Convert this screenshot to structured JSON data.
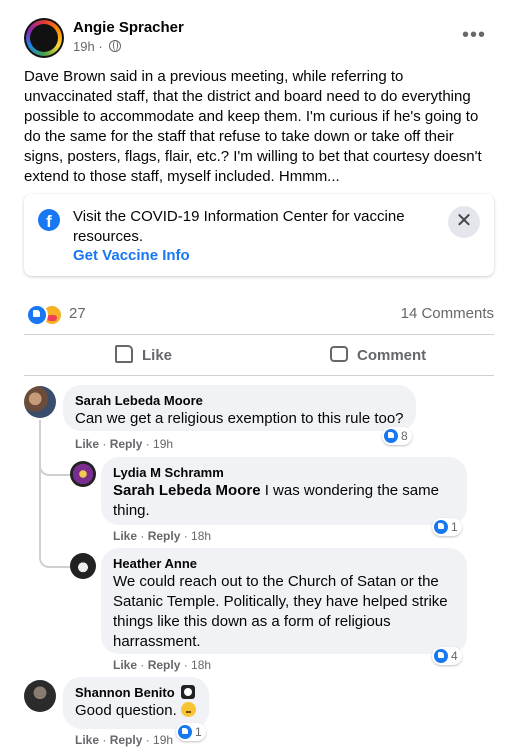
{
  "post": {
    "author": "Angie Spracher",
    "time": "19h",
    "text": "Dave Brown said in a previous meeting, while referring to unvaccinated staff, that the district and board need to do everything possible to accommodate and keep them. I'm curious if he's going to do the same for the staff that refuse to take down or take off their signs, posters, flags, flair, etc.? I'm willing to bet that courtesy doesn't extend to those staff, myself included. Hmmm...",
    "more_icon": "more-horizontal-icon",
    "privacy_icon": "globe-icon"
  },
  "covid_card": {
    "text": "Visit the COVID-19 Information Center for vaccine resources.",
    "link": "Get Vaccine Info",
    "close_icon": "close-icon",
    "brand_color": "#1877f2"
  },
  "stats": {
    "reactions_count": "27",
    "comments_count": "14 Comments"
  },
  "actions": {
    "like": "Like",
    "comment": "Comment"
  },
  "comments": [
    {
      "name": "Sarah Lebeda Moore",
      "text": "Can we get a religious exemption to this rule too?",
      "like_label": "Like",
      "reply_label": "Reply",
      "time": "19h",
      "reactions": "8"
    },
    {
      "name": "Lydia M Schramm",
      "tag": "Sarah Lebeda Moore",
      "text": " I was wondering the same thing.",
      "like_label": "Like",
      "reply_label": "Reply",
      "time": "18h",
      "reactions": "1"
    },
    {
      "name": "Heather Anne",
      "text": "We could reach out to the Church of Satan or the Satanic Temple. Politically, they have helped strike things like this down as a form of religious harrassment.",
      "like_label": "Like",
      "reply_label": "Reply",
      "time": "18h",
      "reactions": "4"
    },
    {
      "name": "Shannon Benito",
      "text": "Good question. ",
      "like_label": "Like",
      "reply_label": "Reply",
      "time": "19h",
      "reactions": "1"
    }
  ]
}
